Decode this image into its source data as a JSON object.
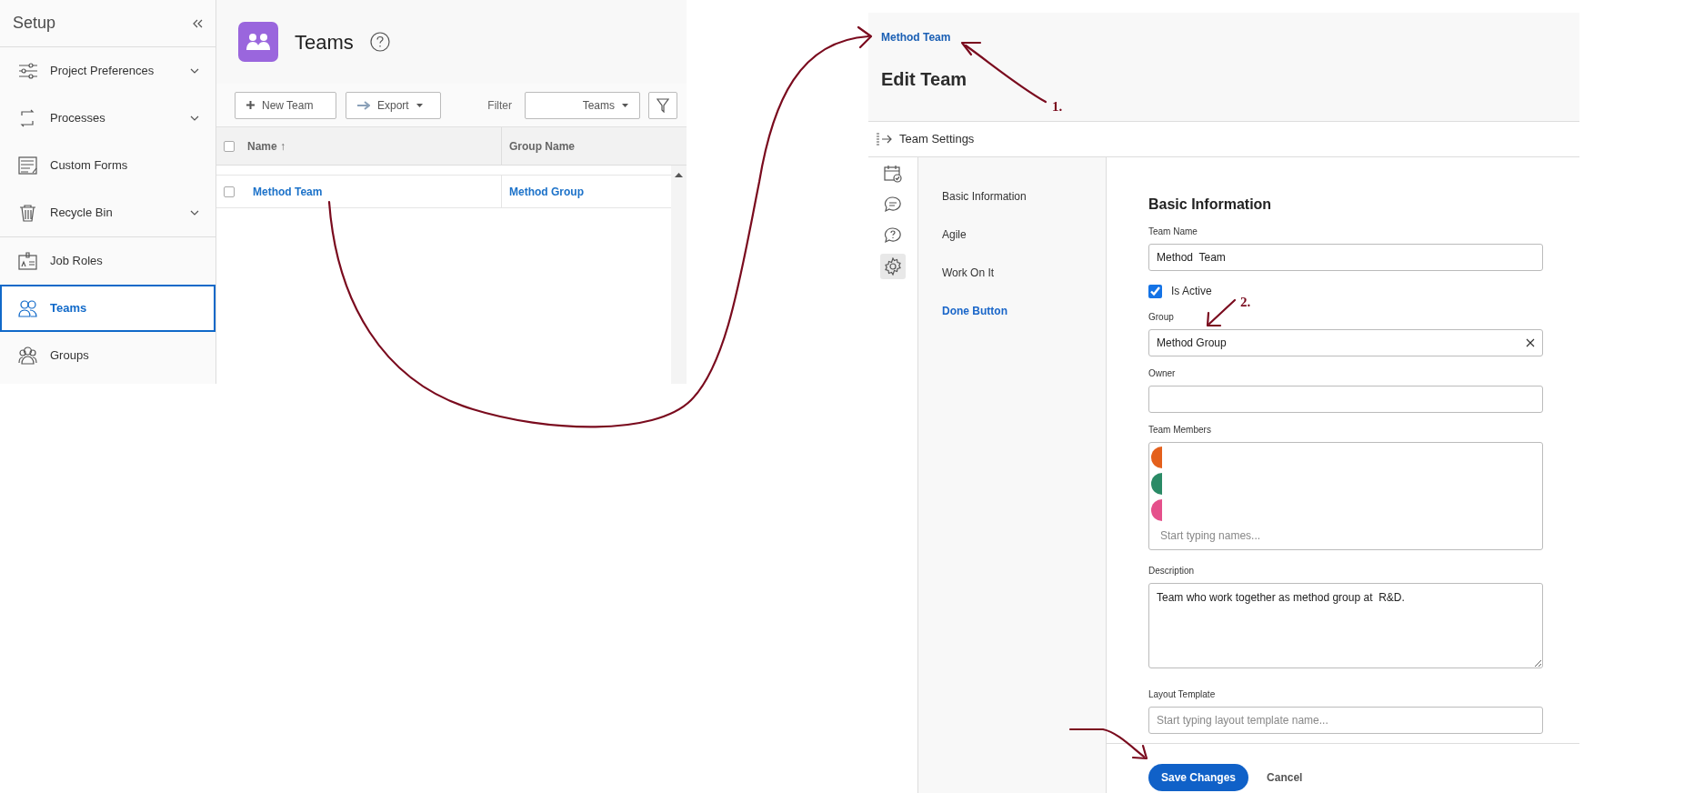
{
  "setup_sidebar": {
    "title": "Setup",
    "sections": [
      [
        {
          "label": "Project Preferences",
          "expandable": true,
          "selected": false
        },
        {
          "label": "Processes",
          "expandable": true,
          "selected": false
        },
        {
          "label": "Custom Forms",
          "expandable": false,
          "selected": false
        },
        {
          "label": "Recycle Bin",
          "expandable": true,
          "selected": false
        }
      ],
      [
        {
          "label": "Job Roles",
          "expandable": false,
          "selected": false
        },
        {
          "label": "Teams",
          "expandable": false,
          "selected": true
        },
        {
          "label": "Groups",
          "expandable": false,
          "selected": false
        }
      ]
    ]
  },
  "teams_page": {
    "title": "Teams",
    "toolbar": {
      "new_button": "New Team",
      "export_button": "Export",
      "filter_label": "Filter",
      "filter_value": "Teams"
    },
    "table": {
      "select_all_checked": false,
      "columns": [
        {
          "label": "Name",
          "sort": "↑"
        },
        {
          "label": "Group Name"
        }
      ],
      "rows": [
        {
          "name": "Method Team",
          "group": "Method Group",
          "checked": false
        }
      ]
    }
  },
  "edit_team": {
    "breadcrumb": "Method Team",
    "title": "Edit Team",
    "settings_label": "Team Settings",
    "rail_icons": [
      {
        "selected": false
      },
      {
        "selected": false
      },
      {
        "selected": false
      },
      {
        "selected": true
      }
    ],
    "nav": [
      {
        "label": "Basic Information",
        "selected": false
      },
      {
        "label": "Agile",
        "selected": false
      },
      {
        "label": "Work On It",
        "selected": false
      },
      {
        "label": "Done Button",
        "selected": true
      }
    ],
    "form": {
      "heading": "Basic Information",
      "team_name": {
        "label": "Team Name",
        "value": "Method  Team"
      },
      "is_active": {
        "label": "Is Active",
        "checked": true
      },
      "group": {
        "label": "Group",
        "value": "Method Group"
      },
      "owner": {
        "label": "Owner"
      },
      "team_members": {
        "label": "Team Members",
        "members": [
          {
            "color": "#e4601c"
          },
          {
            "color": "#2a8a66"
          },
          {
            "color": "#e5508b"
          }
        ],
        "placeholder": "Start typing names..."
      },
      "description": {
        "label": "Description",
        "value": "Team who work together as method group at  R&D."
      },
      "layout_template": {
        "label": "Layout Template",
        "placeholder": "Start typing layout template name..."
      }
    },
    "save_button": "Save Changes",
    "cancel_button": "Cancel"
  },
  "annotations": [
    {
      "label": "1."
    },
    {
      "label": "2."
    }
  ]
}
